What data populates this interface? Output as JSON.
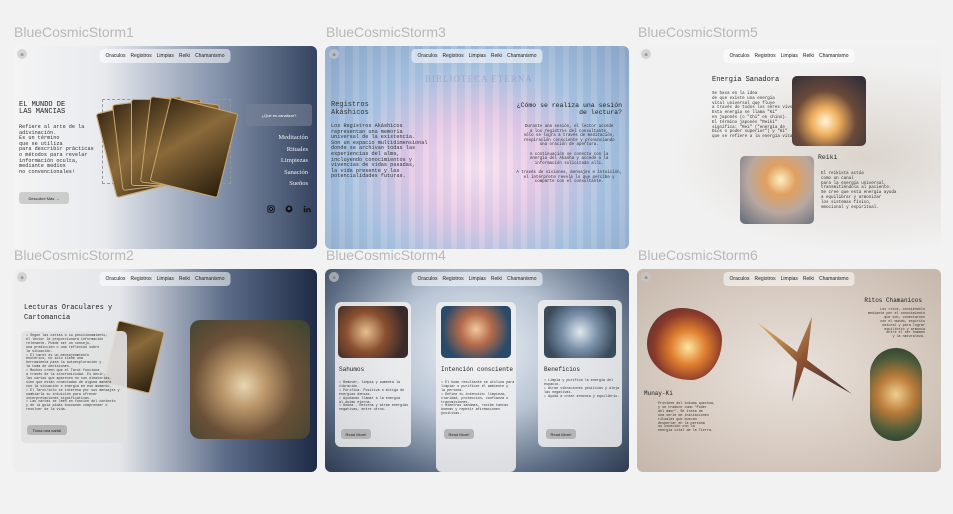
{
  "frames": [
    {
      "title": "BlueCosmicStorm1",
      "nav": [
        "Oraculos",
        "Registros",
        "Limpias",
        "Reiki",
        "Chamanismo"
      ],
      "heading": "EL MUNDO DE\nLAS MANCIAS",
      "body": "Refiere al arte de la\nadivinación.\nEs un término\nque se utiliza\npara describir prácticas\no métodos para revelar\ninformación oculta,\nmediante medios\nno convencionales!",
      "button": "Descubre Más →",
      "side_question": "¿Qué es canalizar?",
      "side_links": [
        "Meditación",
        "Rituales",
        "Limpiezas",
        "Sanación",
        "Sueños"
      ],
      "social_icons": [
        "instagram-icon",
        "github-icon",
        "linkedin-icon"
      ]
    },
    {
      "title": "BlueCosmicStorm3",
      "nav": [
        "Oraculos",
        "Registros",
        "Limpias",
        "Reiki",
        "Chamanismo"
      ],
      "watermark": "BIBLIOTECA ETERNA",
      "heading": "Registros\nAkáshicos",
      "body": "Los Registros Akáshicos\nrepresentan una memoria\nuniversal de la existencia.\nSon un espacio multidimensional\ndonde se archivan todas las\nexperiencias del alma,\nincluyendo conocimientos y\nvivencias de vidas pasadas,\nla vida presente y las\npotencialidades futuras.",
      "right_heading": "¿Cómo se realiza una sesión\nde lectura?",
      "right_body": "Durante una sesión, el lector accede\na los registros del consultante,\nsólo se logra a través de meditación,\nrespiración consciente y pronunciando\nuna oración de apertura.\n\nA continuación se conecta con la\nenergía del Akasha y accede a la\ninformación solicitada allí.\n\nA través de visiones, mensajes e intuición,\nel intérprete revela lo que percibe y\ncomparte con el consultante."
    },
    {
      "title": "BlueCosmicStorm5",
      "nav": [
        "Oraculos",
        "Registros",
        "Limpias",
        "Reiki",
        "Chamanismo"
      ],
      "heading": "Energía Sanadora",
      "body": "Se basa en la idea\nde que existe una energía\nvital universal que fluye\na través de todos los seres vivos.\nEsta energía se llama \"Ki\"\nen japonés (o \"Chi\" en chino).\nEl término japonés \"Reiki\"\nsignifica: \"Rei\" (\"energía de\nDios o poder superior\") y \"Ki\"\nque se refiere a la energía vital.",
      "subheading": "Reiki",
      "body2": "El reikista actúa\ncomo un canal\npara la energía universal,\ntransmitiéndola al paciente.\nSe cree que esta energía ayuda\na equilibrar y armonizar\nlos sistemas físico,\nemocional y espiritual."
    },
    {
      "title": "BlueCosmicStorm2",
      "nav": [
        "Oraculos",
        "Registros",
        "Limpias",
        "Reiki",
        "Chamanismo"
      ],
      "heading": "Lecturas Oraculares y\nCartomancia",
      "body": "• Según las cartas o su posicionamiento,\n  el lector le proporcionará información\n  relevante. Puede ser un consejo,\n  una predicción o una reflexión sobre\n  la situación.\n• El tarot es un mensajeamiento\n  esotérico, no sólo tiene una\n  herramienta para la autoexploración y\n  la toma de decisiones.\n• Muchos creen que el Tarot funciona\n  a través de la sincronicidad. Es decir,\n  las cartas que aparecen no son aleatorias,\n  sino que están conectadas de alguna manera\n  con la situación o energía en ese momento.\n• El Tarot/sólo se interesa por sus mensajes y\n  cambiarla su intuición para ofrecer\n  interpretaciones significativas.\n• Las cartas se leen en función del contexto\n  y de la guía pidas buscando comprender o\n  resolver de la vida.",
      "button": "Toma una carta!"
    },
    {
      "title": "BlueCosmicStorm4",
      "nav": [
        "Oraculos",
        "Registros",
        "Limpias",
        "Reiki",
        "Chamanismo"
      ],
      "cards": [
        {
          "title": "Sahumos",
          "body": "• Remover, limpia y aumenta la\n  vibración.\n• Purifica. Positiva o mitiga de\n  energías densas.\n• Ayudando llamar a la energía\n  al ánimo eterna.\n• Rodea - Retorna y atrae energías\n  negativas, entre otros.",
          "button": "Read More!"
        },
        {
          "title": "Intención consciente",
          "body": "• El humo resultante se utiliza para\n  limpiar o purificar el ambiente y\n  la persona.\n• Define tu intención: limpieza,\n  claridad, protección, confianza o\n  transmisiones.\n• Mientras sahúmas, recibe tantas\n  buenas y repetir afirmaciones\n  positivas.",
          "button": "Read More!"
        },
        {
          "title": "Beneficios",
          "body": "• Limpia y purifica la energía del\n  espacio.\n• Atrae vibraciones positivas y aleja\n  las negativas.\n• Ayuda a crear armonía y equilibrio.",
          "button": "Read More!"
        }
      ]
    },
    {
      "title": "BlueCosmicStorm6",
      "nav": [
        "Oraculos",
        "Registros",
        "Limpias",
        "Reiki",
        "Chamanismo"
      ],
      "heading": "Ritos Chamanicos",
      "body": "Los ritos, consiéndolo\nmediante por el conocimiento\nque son, conectarnos\ncon el mundo, espíritu\nnatural y para lograr\nequilibrio y armonía\nentre el ser humano\ny la naturaleza.",
      "subheading": "Munay-Ki",
      "body2": "Proviene del idioma quechua,\ny se traduce como \"Poder\ndel amor\". Se trata de\nuna serie de iniciaciones\nrituales que buscan\ndespertar en la persona\nsu conexión con la\nenergía vital de la Tierra."
    }
  ]
}
